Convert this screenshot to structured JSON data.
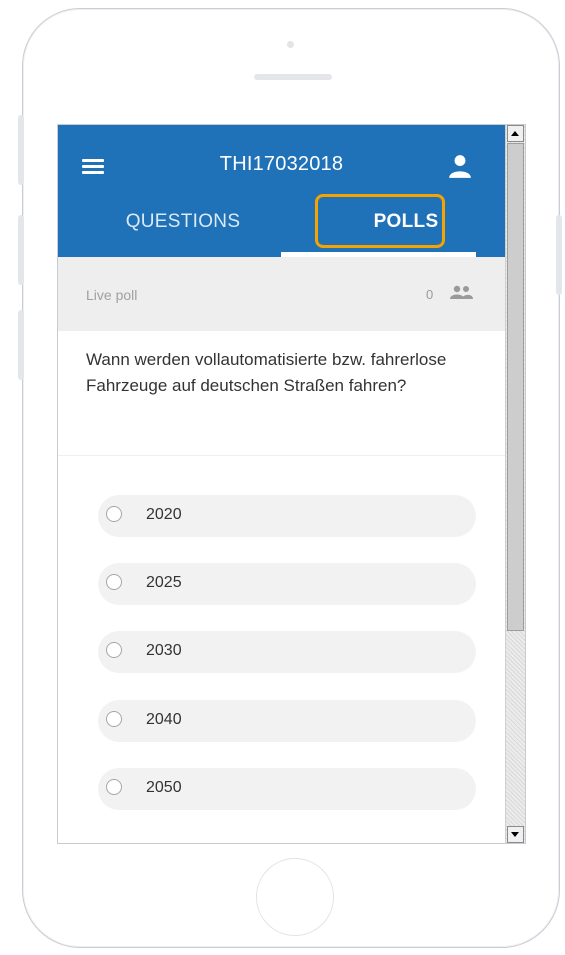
{
  "header": {
    "title": "THI17032018"
  },
  "tabs": [
    {
      "label": "QUESTIONS",
      "active": false
    },
    {
      "label": "POLLS",
      "active": true
    }
  ],
  "poll": {
    "status_label": "Live poll",
    "participant_count": "0",
    "question": "Wann werden vollautomatisierte bzw. fahrerlose Fahrzeuge auf deutschen Straßen fahren?",
    "options": [
      "2020",
      "2025",
      "2030",
      "2040",
      "2050"
    ]
  },
  "icons": {
    "menu": "hamburger-menu",
    "user": "person",
    "participants": "people-group"
  },
  "colors": {
    "appbar": "#1f72b7",
    "tab_highlight": "#f5a300",
    "poll_header_bg": "#eeeeee",
    "option_bg": "#f2f2f2"
  }
}
